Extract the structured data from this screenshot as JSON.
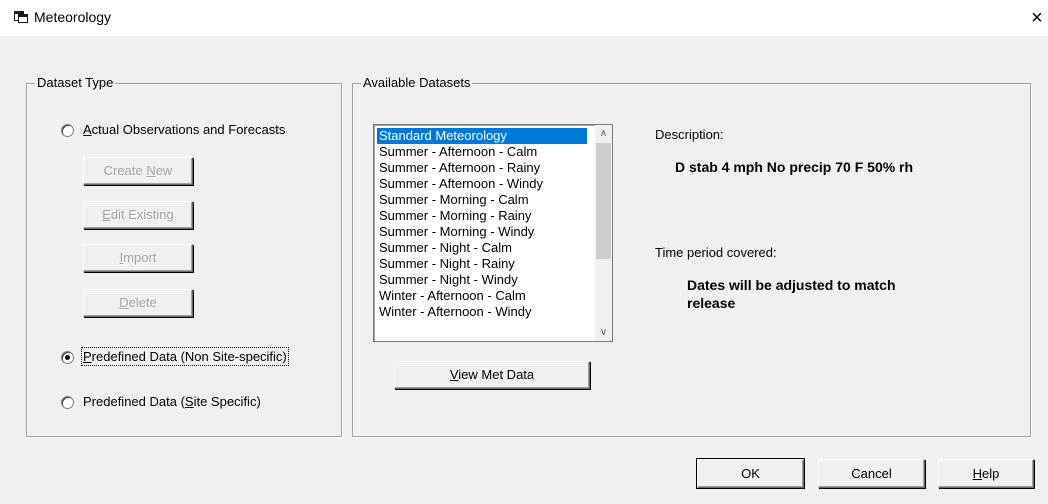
{
  "window": {
    "title": "Meteorology",
    "close_glyph": "×"
  },
  "dataset_type": {
    "legend": "Dataset Type",
    "options": [
      {
        "pre": "",
        "key": "A",
        "post": "ctual Observations and Forecasts",
        "checked": false
      },
      {
        "pre": "",
        "key": "P",
        "post": "redefined Data (Non Site-specific)",
        "checked": true
      },
      {
        "pre": "Predefined Data (",
        "key": "S",
        "post": "ite Specific)",
        "checked": false
      }
    ],
    "buttons": [
      {
        "pre": "Create ",
        "key": "N",
        "post": "ew"
      },
      {
        "pre": "",
        "key": "E",
        "post": "dit Existing"
      },
      {
        "pre": "",
        "key": "I",
        "post": "mport"
      },
      {
        "pre": "",
        "key": "D",
        "post": "elete"
      }
    ]
  },
  "available_datasets": {
    "legend": "Available Datasets",
    "items": [
      "Standard Meteorology",
      "Summer - Afternoon - Calm",
      "Summer - Afternoon - Rainy",
      "Summer - Afternoon - Windy",
      "Summer - Morning - Calm",
      "Summer - Morning - Rainy",
      "Summer - Morning - Windy",
      "Summer - Night - Calm",
      "Summer - Night - Rainy",
      "Summer - Night - Windy",
      "Winter - Afternoon - Calm",
      "Winter - Afternoon - Windy"
    ],
    "selected_index": 0,
    "view_button": {
      "pre": "",
      "key": "V",
      "post": "iew Met Data"
    },
    "description_label": "Description:",
    "description_value": "D stab 4 mph No precip 70 F 50% rh",
    "time_label": "Time period covered:",
    "time_value_line1": "Dates will be adjusted to match",
    "time_value_line2": "release"
  },
  "footer": {
    "ok": {
      "pre": "OK",
      "key": "",
      "post": ""
    },
    "cancel": {
      "pre": "Cancel",
      "key": "",
      "post": ""
    },
    "help": {
      "pre": "",
      "key": "H",
      "post": "elp"
    }
  }
}
